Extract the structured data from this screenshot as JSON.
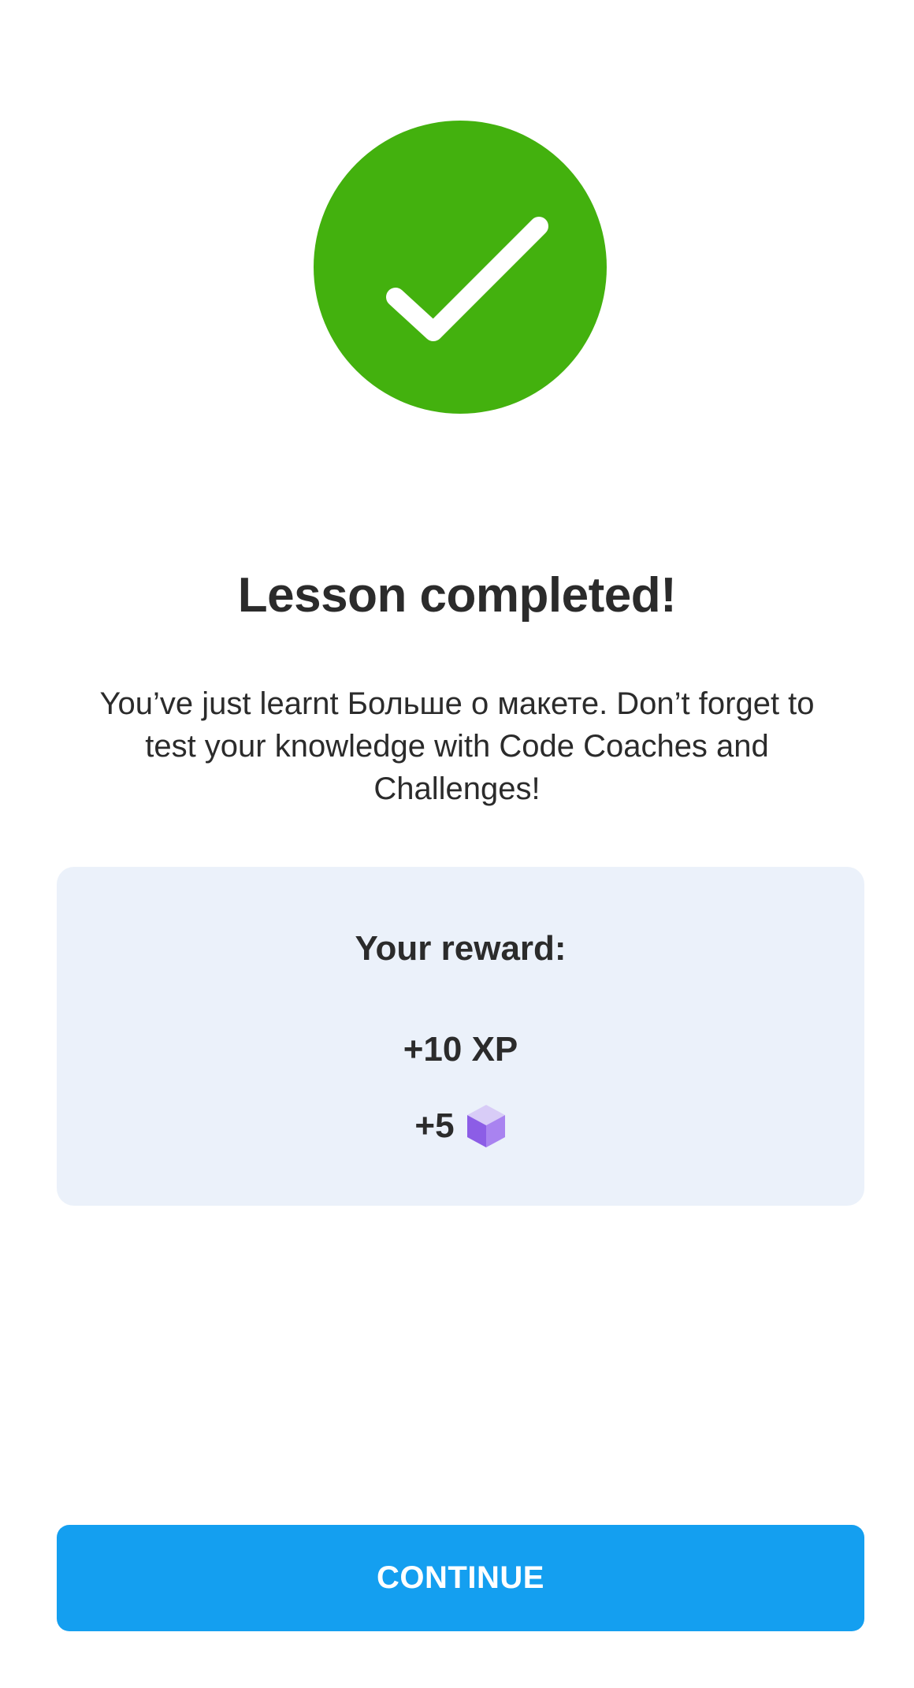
{
  "success_icon": {
    "icon": "checkmark-icon",
    "color": "#43b10e"
  },
  "title": "Lesson completed!",
  "message": "You’ve just learnt Больше о макете. Don’t forget to test your knowledge with Code Coaches and Challenges!",
  "reward": {
    "heading": "Your reward:",
    "xp": "+10 XP",
    "bits": "+5",
    "bits_icon": "cube-icon",
    "card_color": "#ebf1fa"
  },
  "continue_button": {
    "label": "CONTINUE",
    "color": "#149ff0"
  }
}
